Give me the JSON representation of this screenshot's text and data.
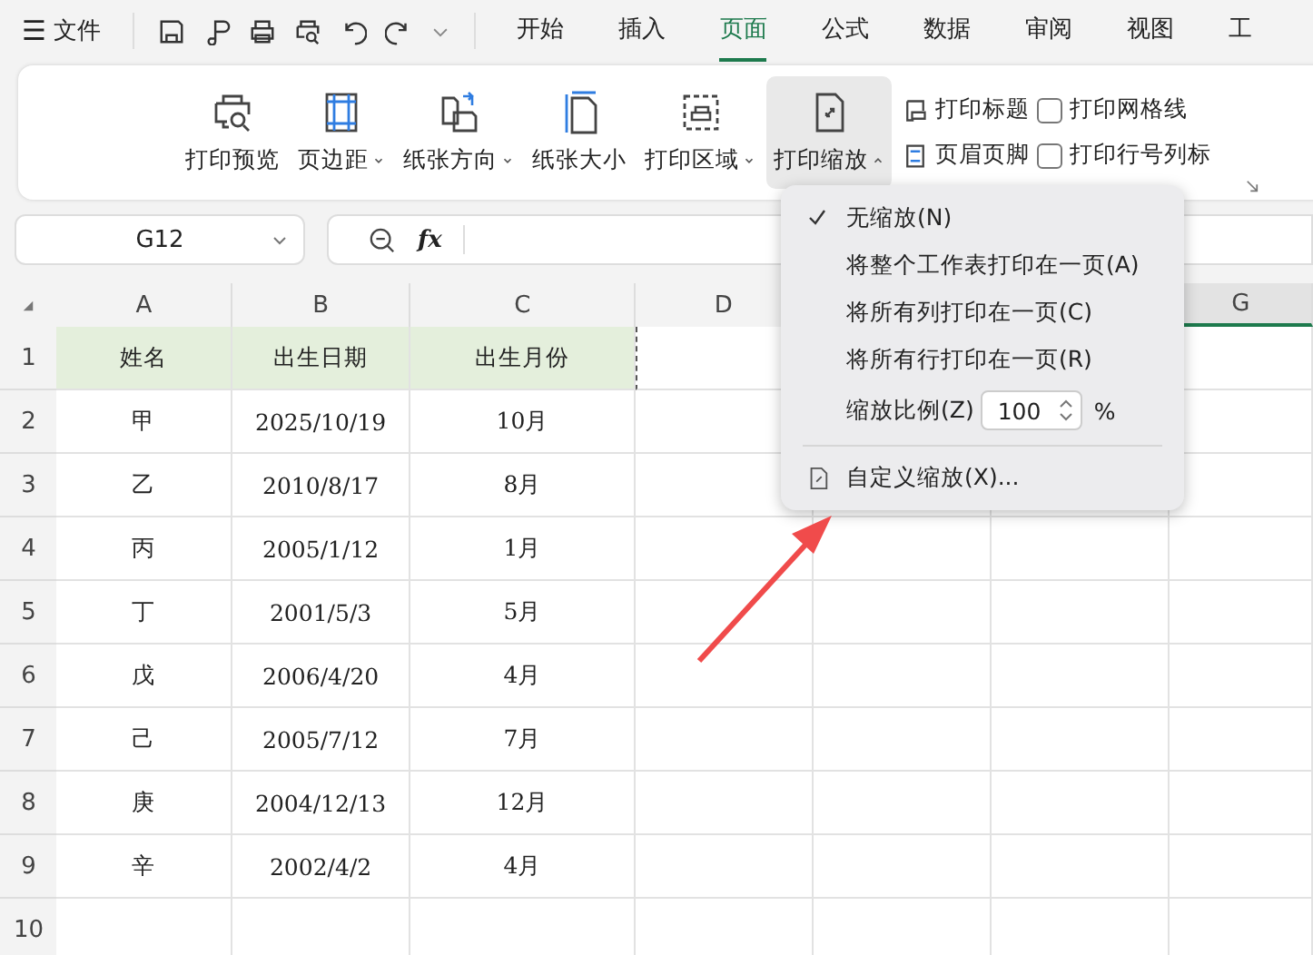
{
  "menu_bar": {
    "menu_label": "☰",
    "file": "文件"
  },
  "tabs": [
    {
      "label": "开始",
      "selected": false
    },
    {
      "label": "插入",
      "selected": false
    },
    {
      "label": "页面",
      "selected": true
    },
    {
      "label": "公式",
      "selected": false
    },
    {
      "label": "数据",
      "selected": false
    },
    {
      "label": "审阅",
      "selected": false
    },
    {
      "label": "视图",
      "selected": false
    },
    {
      "label": "工",
      "selected": false
    }
  ],
  "ribbon": {
    "big_buttons": [
      {
        "label": "打印预览",
        "dropdown": false,
        "active": false
      },
      {
        "label": "页边距",
        "dropdown": true,
        "active": false
      },
      {
        "label": "纸张方向",
        "dropdown": true,
        "active": false
      },
      {
        "label": "纸张大小",
        "dropdown": false,
        "active": false
      },
      {
        "label": "打印区域",
        "dropdown": true,
        "active": false
      },
      {
        "label": "打印缩放",
        "dropdown": true,
        "active": true
      }
    ],
    "small_buttons": [
      {
        "label": "打印标题"
      },
      {
        "label": "页眉页脚"
      }
    ],
    "checkboxes": [
      {
        "label": "打印网格线",
        "checked": false
      },
      {
        "label": "打印行号列标",
        "checked": false
      }
    ]
  },
  "name_box": {
    "value": "G12"
  },
  "formula_bar": {
    "fx": "fx"
  },
  "columns": [
    {
      "label": "A",
      "selected": false
    },
    {
      "label": "B",
      "selected": false
    },
    {
      "label": "C",
      "selected": false
    },
    {
      "label": "D",
      "selected": false
    },
    {
      "label": "G",
      "selected": true
    }
  ],
  "rows": [
    {
      "num": "1",
      "cells": [
        "姓名",
        "出生日期",
        "出生月份"
      ],
      "header": true
    },
    {
      "num": "2",
      "cells": [
        "甲",
        "2025/10/19",
        "10月"
      ],
      "header": false
    },
    {
      "num": "3",
      "cells": [
        "乙",
        "2010/8/17",
        "8月"
      ],
      "header": false
    },
    {
      "num": "4",
      "cells": [
        "丙",
        "2005/1/12",
        "1月"
      ],
      "header": false
    },
    {
      "num": "5",
      "cells": [
        "丁",
        "2001/5/3",
        "5月"
      ],
      "header": false
    },
    {
      "num": "6",
      "cells": [
        "戊",
        "2006/4/20",
        "4月"
      ],
      "header": false
    },
    {
      "num": "7",
      "cells": [
        "己",
        "2005/7/12",
        "7月"
      ],
      "header": false
    },
    {
      "num": "8",
      "cells": [
        "庚",
        "2004/12/13",
        "12月"
      ],
      "header": false
    },
    {
      "num": "9",
      "cells": [
        "辛",
        "2002/4/2",
        "4月"
      ],
      "header": false
    },
    {
      "num": "10",
      "cells": [],
      "header": false
    }
  ],
  "scale_menu": {
    "items": [
      {
        "kind": "option",
        "label": "无缩放(N)",
        "selected": true
      },
      {
        "kind": "option",
        "label": "将整个工作表打印在一页(A)",
        "selected": false
      },
      {
        "kind": "option",
        "label": "将所有列打印在一页(C)",
        "selected": false
      },
      {
        "kind": "option",
        "label": "将所有行打印在一页(R)",
        "selected": false
      },
      {
        "kind": "scale",
        "label": "缩放比例(Z)",
        "value": "100",
        "unit": "%"
      },
      {
        "kind": "custom",
        "label": "自定义缩放(X)..."
      }
    ]
  }
}
